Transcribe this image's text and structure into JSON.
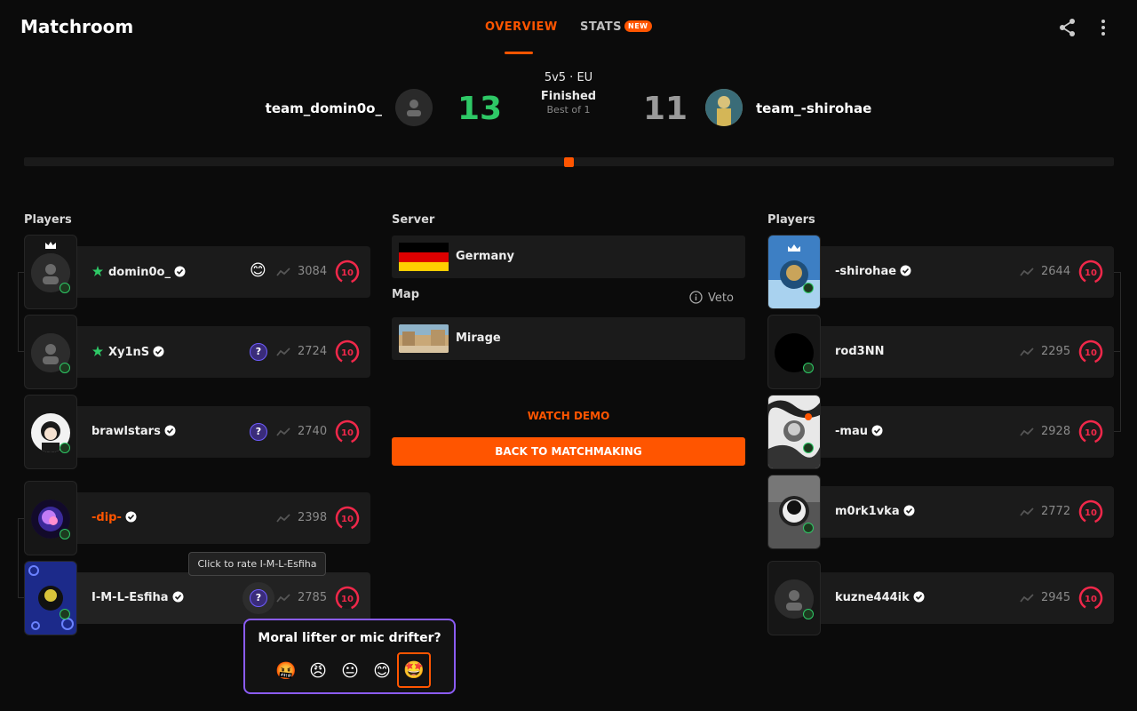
{
  "header": {
    "title": "Matchroom",
    "tabs": [
      {
        "label": "OVERVIEW"
      },
      {
        "label": "STATS",
        "badge": "NEW"
      }
    ],
    "icons": [
      "share-icon",
      "more-vertical-icon"
    ]
  },
  "match": {
    "mode": "5v5 · EU",
    "status": "Finished",
    "format": "Best of 1",
    "team_left": {
      "name": "team_domin0o_",
      "score": "13"
    },
    "team_right": {
      "name": "team_-shirohae",
      "score": "11"
    },
    "colors": {
      "win": "#2ec866",
      "loss": "#9a9a9a",
      "accent": "#ff5500"
    }
  },
  "left_team": {
    "label": "Players",
    "players": [
      {
        "name": "domin0o_",
        "elo": "3084",
        "level": "10",
        "rating": "😊",
        "captain": true
      },
      {
        "name": "Xy1nS",
        "elo": "2724",
        "level": "10",
        "rating": "?"
      },
      {
        "name": "brawlstars",
        "elo": "2740",
        "level": "10",
        "rating": "?"
      },
      {
        "name": "-dip-",
        "elo": "2398",
        "level": "10"
      },
      {
        "name": "I-M-L-Esfiha",
        "elo": "2785",
        "level": "10",
        "rating": "?"
      }
    ]
  },
  "right_team": {
    "label": "Players",
    "players": [
      {
        "name": "-shirohae",
        "elo": "2644",
        "level": "10",
        "captain": true
      },
      {
        "name": "rod3NN",
        "elo": "2295",
        "level": "10"
      },
      {
        "name": "-mau",
        "elo": "2928",
        "level": "10"
      },
      {
        "name": "m0rk1vka",
        "elo": "2772",
        "level": "10"
      },
      {
        "name": "kuzne444ik",
        "elo": "2945",
        "level": "10"
      }
    ]
  },
  "center": {
    "server_label": "Server",
    "server": "Germany",
    "map_label": "Map",
    "map": "Mirage",
    "veto": "Veto",
    "watch_demo": "WATCH DEMO",
    "back_button": "BACK TO MATCHMAKING"
  },
  "tooltip": "Click to rate I-M-L-Esfiha",
  "rating_popup": {
    "title": "Moral lifter or mic drifter?",
    "options": [
      "🤬",
      "😠",
      "😐",
      "😊",
      "🤩"
    ]
  }
}
